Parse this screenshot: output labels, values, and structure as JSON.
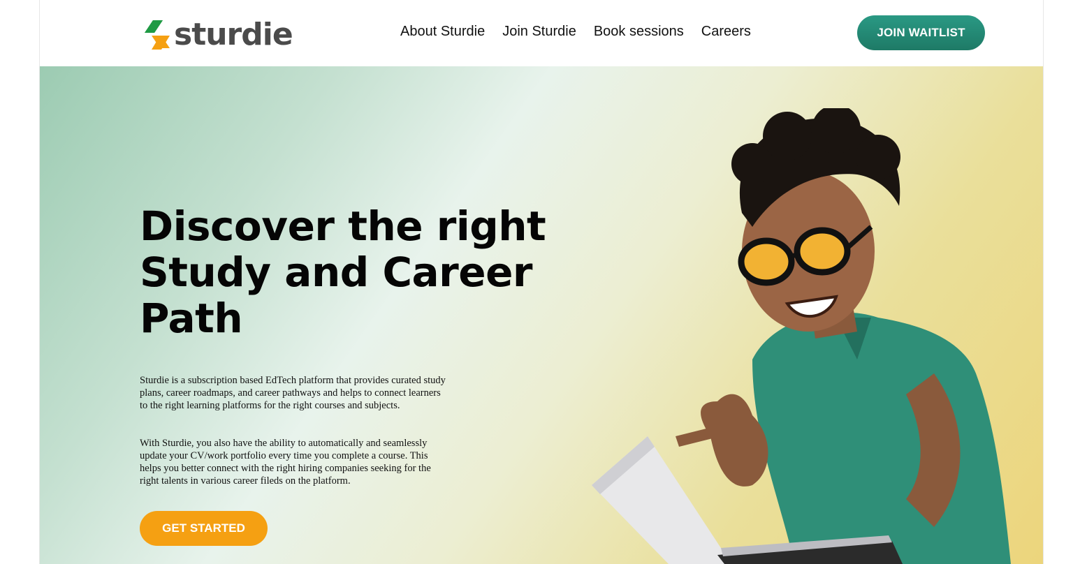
{
  "brand": {
    "name": "sturdie",
    "colors": {
      "green": "#1f9a44",
      "orange": "#f5a012",
      "teal": "#1e7a66"
    }
  },
  "nav": {
    "items": [
      {
        "label": "About Sturdie"
      },
      {
        "label": "Join Sturdie"
      },
      {
        "label": "Book sessions"
      },
      {
        "label": "Careers"
      }
    ],
    "cta_label": "JOIN WAITLIST"
  },
  "hero": {
    "title": "Discover the right Study and Career Path",
    "paragraph_1": "Sturdie is a subscription based EdTech platform that provides curated study plans, career roadmaps, and career pathways and helps to connect learners to the right learning platforms for the right courses and subjects.",
    "paragraph_2": "With Sturdie, you also have the ability to automatically and seamlessly update your CV/work portfolio every time you complete a course. This helps you better connect with the right hiring companies seeking for the right talents in various career fileds on the platform.",
    "cta_label": "GET STARTED",
    "image_icon": "excited-student-laptop-illustration"
  }
}
